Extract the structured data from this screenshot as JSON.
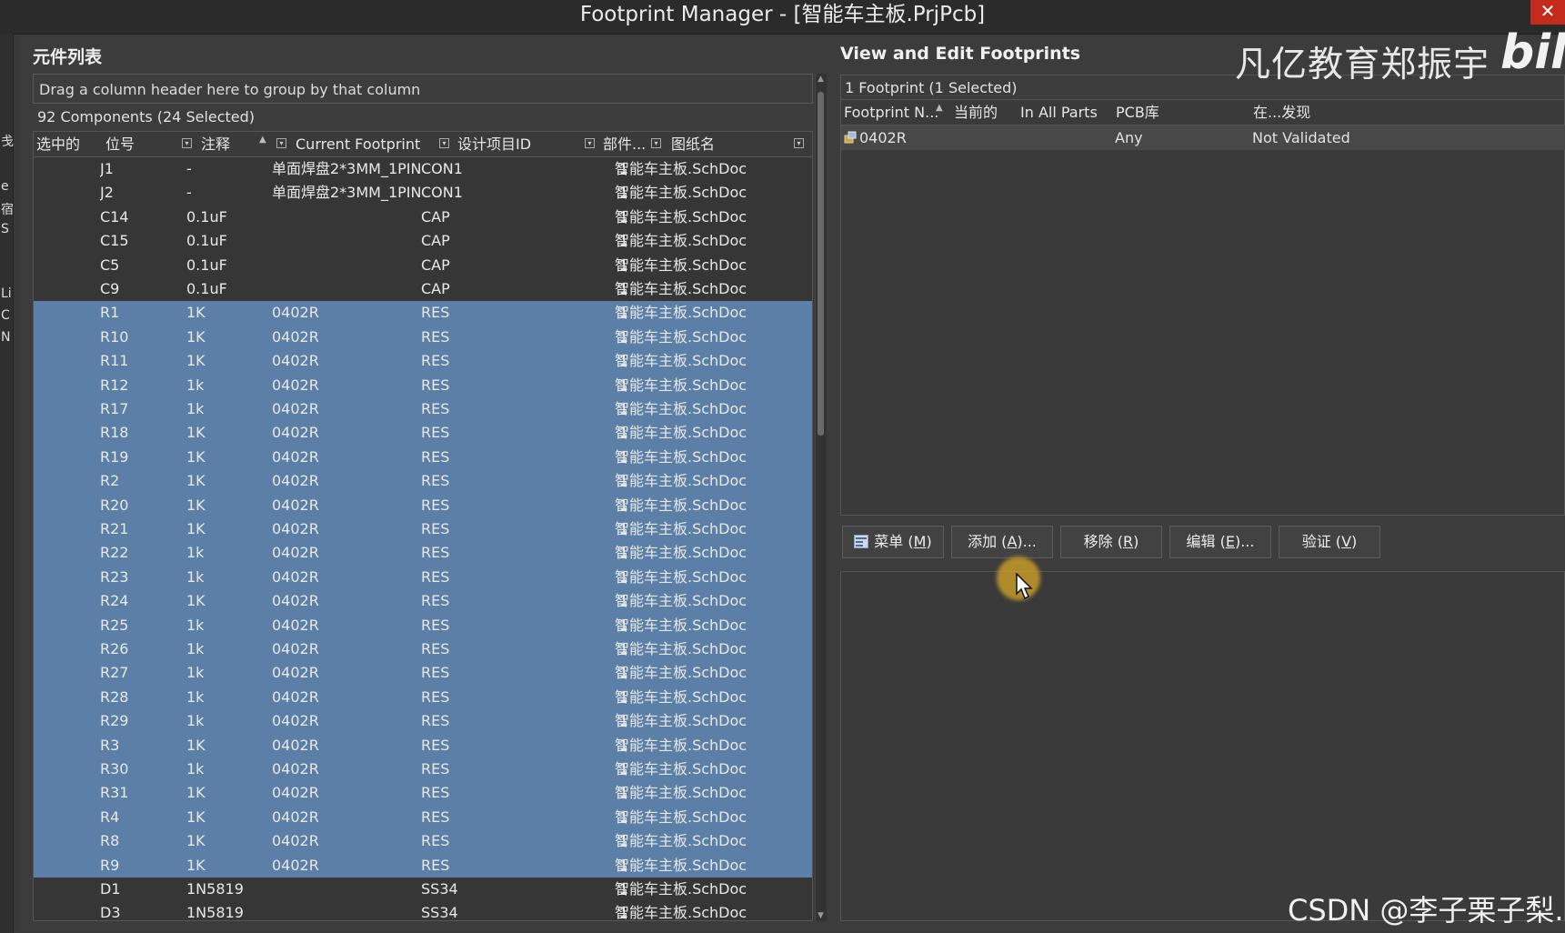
{
  "window": {
    "title": "Footprint Manager - [智能车主板.PrjPcb]",
    "close_glyph": "✕"
  },
  "left_strip_glyphs": [
    "戋",
    "e",
    "宿",
    "S",
    "Li",
    "C",
    "N"
  ],
  "left_panel": {
    "title": "元件列表",
    "group_hint": "Drag a column header here to group by that column",
    "count_text": "92 Components (24 Selected)",
    "columns": [
      "选中的",
      "位号",
      "注释",
      "Current Footprint",
      "设计项目ID",
      "部件...",
      "图纸名"
    ],
    "rows": [
      {
        "designator": "J1",
        "comment": "-",
        "footprint": "单面焊盘2*3MM_1PIN",
        "design_id": "CON1",
        "part": "1",
        "sheet": "智能车主板.SchDoc",
        "selected": false
      },
      {
        "designator": "J2",
        "comment": "-",
        "footprint": "单面焊盘2*3MM_1PIN",
        "design_id": "CON1",
        "part": "1",
        "sheet": "智能车主板.SchDoc",
        "selected": false
      },
      {
        "designator": "C14",
        "comment": "0.1uF",
        "footprint": "",
        "design_id": "CAP",
        "part": "1",
        "sheet": "智能车主板.SchDoc",
        "selected": false
      },
      {
        "designator": "C15",
        "comment": "0.1uF",
        "footprint": "",
        "design_id": "CAP",
        "part": "1",
        "sheet": "智能车主板.SchDoc",
        "selected": false
      },
      {
        "designator": "C5",
        "comment": "0.1uF",
        "footprint": "",
        "design_id": "CAP",
        "part": "1",
        "sheet": "智能车主板.SchDoc",
        "selected": false
      },
      {
        "designator": "C9",
        "comment": "0.1uF",
        "footprint": "",
        "design_id": "CAP",
        "part": "1",
        "sheet": "智能车主板.SchDoc",
        "selected": false
      },
      {
        "designator": "R1",
        "comment": "1K",
        "footprint": "0402R",
        "design_id": "RES",
        "part": "1",
        "sheet": "智能车主板.SchDoc",
        "selected": true
      },
      {
        "designator": "R10",
        "comment": "1K",
        "footprint": "0402R",
        "design_id": "RES",
        "part": "1",
        "sheet": "智能车主板.SchDoc",
        "selected": true
      },
      {
        "designator": "R11",
        "comment": "1K",
        "footprint": "0402R",
        "design_id": "RES",
        "part": "1",
        "sheet": "智能车主板.SchDoc",
        "selected": true
      },
      {
        "designator": "R12",
        "comment": "1k",
        "footprint": "0402R",
        "design_id": "RES",
        "part": "1",
        "sheet": "智能车主板.SchDoc",
        "selected": true
      },
      {
        "designator": "R17",
        "comment": "1k",
        "footprint": "0402R",
        "design_id": "RES",
        "part": "1",
        "sheet": "智能车主板.SchDoc",
        "selected": true
      },
      {
        "designator": "R18",
        "comment": "1K",
        "footprint": "0402R",
        "design_id": "RES",
        "part": "1",
        "sheet": "智能车主板.SchDoc",
        "selected": true
      },
      {
        "designator": "R19",
        "comment": "1K",
        "footprint": "0402R",
        "design_id": "RES",
        "part": "1",
        "sheet": "智能车主板.SchDoc",
        "selected": true
      },
      {
        "designator": "R2",
        "comment": "1K",
        "footprint": "0402R",
        "design_id": "RES",
        "part": "1",
        "sheet": "智能车主板.SchDoc",
        "selected": true
      },
      {
        "designator": "R20",
        "comment": "1K",
        "footprint": "0402R",
        "design_id": "RES",
        "part": "1",
        "sheet": "智能车主板.SchDoc",
        "selected": true
      },
      {
        "designator": "R21",
        "comment": "1K",
        "footprint": "0402R",
        "design_id": "RES",
        "part": "1",
        "sheet": "智能车主板.SchDoc",
        "selected": true
      },
      {
        "designator": "R22",
        "comment": "1k",
        "footprint": "0402R",
        "design_id": "RES",
        "part": "1",
        "sheet": "智能车主板.SchDoc",
        "selected": true
      },
      {
        "designator": "R23",
        "comment": "1k",
        "footprint": "0402R",
        "design_id": "RES",
        "part": "1",
        "sheet": "智能车主板.SchDoc",
        "selected": true
      },
      {
        "designator": "R24",
        "comment": "1K",
        "footprint": "0402R",
        "design_id": "RES",
        "part": "1",
        "sheet": "智能车主板.SchDoc",
        "selected": true
      },
      {
        "designator": "R25",
        "comment": "1k",
        "footprint": "0402R",
        "design_id": "RES",
        "part": "1",
        "sheet": "智能车主板.SchDoc",
        "selected": true
      },
      {
        "designator": "R26",
        "comment": "1k",
        "footprint": "0402R",
        "design_id": "RES",
        "part": "1",
        "sheet": "智能车主板.SchDoc",
        "selected": true
      },
      {
        "designator": "R27",
        "comment": "1k",
        "footprint": "0402R",
        "design_id": "RES",
        "part": "1",
        "sheet": "智能车主板.SchDoc",
        "selected": true
      },
      {
        "designator": "R28",
        "comment": "1k",
        "footprint": "0402R",
        "design_id": "RES",
        "part": "1",
        "sheet": "智能车主板.SchDoc",
        "selected": true
      },
      {
        "designator": "R29",
        "comment": "1k",
        "footprint": "0402R",
        "design_id": "RES",
        "part": "1",
        "sheet": "智能车主板.SchDoc",
        "selected": true
      },
      {
        "designator": "R3",
        "comment": "1K",
        "footprint": "0402R",
        "design_id": "RES",
        "part": "1",
        "sheet": "智能车主板.SchDoc",
        "selected": true
      },
      {
        "designator": "R30",
        "comment": "1k",
        "footprint": "0402R",
        "design_id": "RES",
        "part": "1",
        "sheet": "智能车主板.SchDoc",
        "selected": true
      },
      {
        "designator": "R31",
        "comment": "1K",
        "footprint": "0402R",
        "design_id": "RES",
        "part": "1",
        "sheet": "智能车主板.SchDoc",
        "selected": true
      },
      {
        "designator": "R4",
        "comment": "1K",
        "footprint": "0402R",
        "design_id": "RES",
        "part": "1",
        "sheet": "智能车主板.SchDoc",
        "selected": true
      },
      {
        "designator": "R8",
        "comment": "1K",
        "footprint": "0402R",
        "design_id": "RES",
        "part": "1",
        "sheet": "智能车主板.SchDoc",
        "selected": true
      },
      {
        "designator": "R9",
        "comment": "1K",
        "footprint": "0402R",
        "design_id": "RES",
        "part": "1",
        "sheet": "智能车主板.SchDoc",
        "selected": true
      },
      {
        "designator": "D1",
        "comment": "1N5819",
        "footprint": "",
        "design_id": "SS34",
        "part": "1",
        "sheet": "智能车主板.SchDoc",
        "selected": false
      },
      {
        "designator": "D3",
        "comment": "1N5819",
        "footprint": "",
        "design_id": "SS34",
        "part": "1",
        "sheet": "智能车主板.SchDoc",
        "selected": false
      }
    ]
  },
  "right_panel": {
    "title": "View and Edit Footprints",
    "count_text": "1 Footprint (1 Selected)",
    "columns": [
      "Footprint N...",
      "当前的",
      "In All Parts",
      "PCB库",
      "在...发现"
    ],
    "rows": [
      {
        "name": "0402R",
        "current": "",
        "in_all_parts": "",
        "pcb_lib": "Any",
        "found_in": "Not Validated"
      }
    ],
    "buttons": {
      "menu": {
        "label": "菜单 (",
        "key": "M",
        "suffix": ")"
      },
      "add": {
        "label": "添加 (",
        "key": "A",
        "suffix": ")..."
      },
      "remove": {
        "label": "移除 (",
        "key": "R",
        "suffix": ")"
      },
      "edit": {
        "label": "编辑 (",
        "key": "E",
        "suffix": ")..."
      },
      "validate": {
        "label": "验证 (",
        "key": "V",
        "suffix": ")"
      }
    }
  },
  "watermarks": {
    "top": "凡亿教育郑振宇",
    "logo": "bili",
    "bottom": "CSDN @李子栗子梨."
  },
  "colors": {
    "selected_row": "#5b7fa6",
    "background": "#3a3a3a",
    "close": "#c42b1c"
  }
}
